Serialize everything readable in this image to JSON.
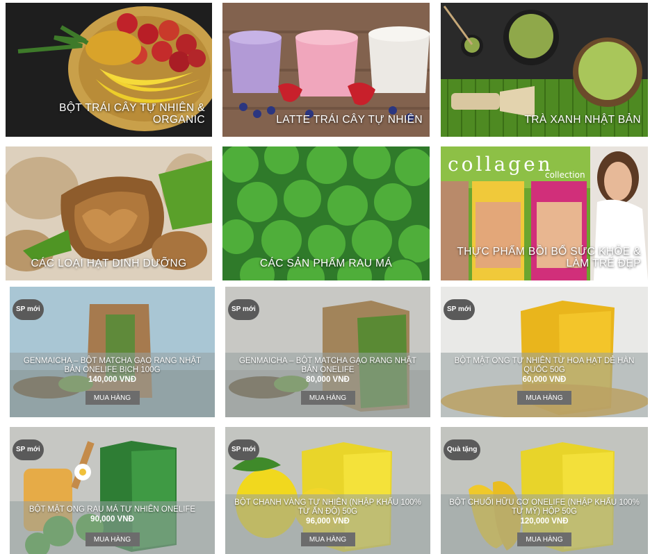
{
  "categories": [
    {
      "label": "BỘT TRÁI CÂY TỰ NHIÊN & ORGANIC"
    },
    {
      "label": "LATTE TRÁI CÂY TỰ NHIÊN"
    },
    {
      "label": "TRÀ XANH NHẬT BẢN"
    },
    {
      "label": "CÁC LOẠI HẠT DINH DƯỠNG"
    },
    {
      "label": "CÁC SẢN PHẨM RAU MÁ"
    },
    {
      "label": "THỰC PHẨM BỒI BỔ SỨC KHỎE & LÀM TRẺ ĐẸP",
      "image_text": "collagen",
      "image_text2": "collection"
    }
  ],
  "products": [
    {
      "badge": "SP mới",
      "name": "GENMAICHA – BỘT MATCHA GẠO RANG NHẬT BẢN ONELIFE BỊCH 100G",
      "price": "140,000 VNĐ",
      "button": "MUA HÀNG"
    },
    {
      "badge": "SP mới",
      "name": "GENMAICHA – BỘT MATCHA GẠO RANG NHẬT BẢN ONELIFE",
      "price": "80,000 VNĐ",
      "button": "MUA HÀNG"
    },
    {
      "badge": "SP mới",
      "name": "BỘT MẬT ONG TỰ NHIÊN TỪ HOA HẠT DẺ HÀN QUỐC 50G",
      "price": "60,000 VNĐ",
      "button": "MUA HÀNG"
    },
    {
      "badge": "SP mới",
      "name": "BỘT MẬT ONG RAU MÁ TỰ NHIÊN ONELIFE",
      "price": "90,000 VNĐ",
      "button": "MUA HÀNG"
    },
    {
      "badge": "SP mới",
      "name": "BỘT CHANH VÀNG TỰ NHIÊN (NHẬP KHẨU 100% TỪ ẤN ĐỘ) 50G",
      "price": "96,000 VNĐ",
      "button": "MUA HÀNG"
    },
    {
      "badge": "Quà tặng",
      "name": "BỘT CHUỐI HỮU CƠ ONELIFE (NHẬP KHẨU 100% TỪ MỸ) HỘP 50G",
      "price": "120,000 VNĐ",
      "button": "MUA HÀNG"
    }
  ]
}
